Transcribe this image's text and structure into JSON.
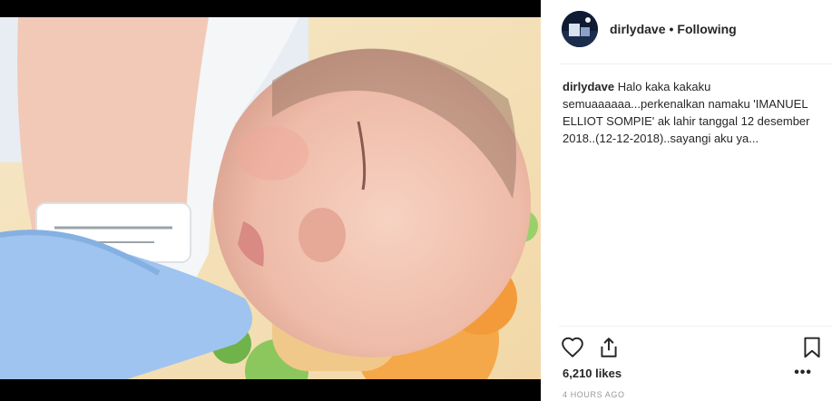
{
  "post": {
    "username": "dirlydave",
    "separator": "•",
    "follow_status": "Following",
    "caption_user": "dirlydave",
    "caption_text": "Halo kaka kakaku semuaaaaaa...perkenalkan namaku 'IMANUEL ELLIOT SOMPIE' ak lahir tanggal 12 desember 2018..(12-12-2018)..sayangi aku ya...",
    "likes": "6,210 likes",
    "timestamp": "4 HOURS AGO",
    "more_label": "•••"
  },
  "icons": {
    "like": "heart-outline-icon",
    "share": "share-icon",
    "save": "bookmark-icon"
  },
  "colors": {
    "text": "#262626",
    "muted": "#999999",
    "divider": "#efefef"
  }
}
